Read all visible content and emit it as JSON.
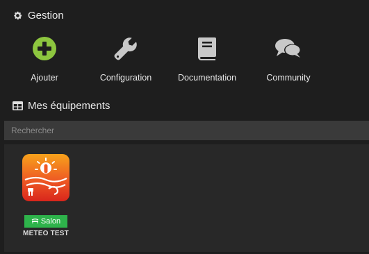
{
  "gestion": {
    "title": "Gestion",
    "icon": "gear-icon",
    "actions": [
      {
        "label": "Ajouter",
        "icon": "plus-circle-icon",
        "color": "#8dc63f"
      },
      {
        "label": "Configuration",
        "icon": "wrench-icon",
        "color": "#c8c8c8"
      },
      {
        "label": "Documentation",
        "icon": "book-icon",
        "color": "#c8c8c8"
      },
      {
        "label": "Community",
        "icon": "comments-icon",
        "color": "#c8c8c8"
      }
    ]
  },
  "equipments": {
    "title": "Mes équipements",
    "icon": "table-icon",
    "search_placeholder": "Rechercher",
    "items": [
      {
        "name": "METEO TEST",
        "room": "Salon",
        "room_icon": "room-icon",
        "badge_color": "#2eb34b",
        "thumb": "weather-plugin-icon"
      }
    ]
  }
}
